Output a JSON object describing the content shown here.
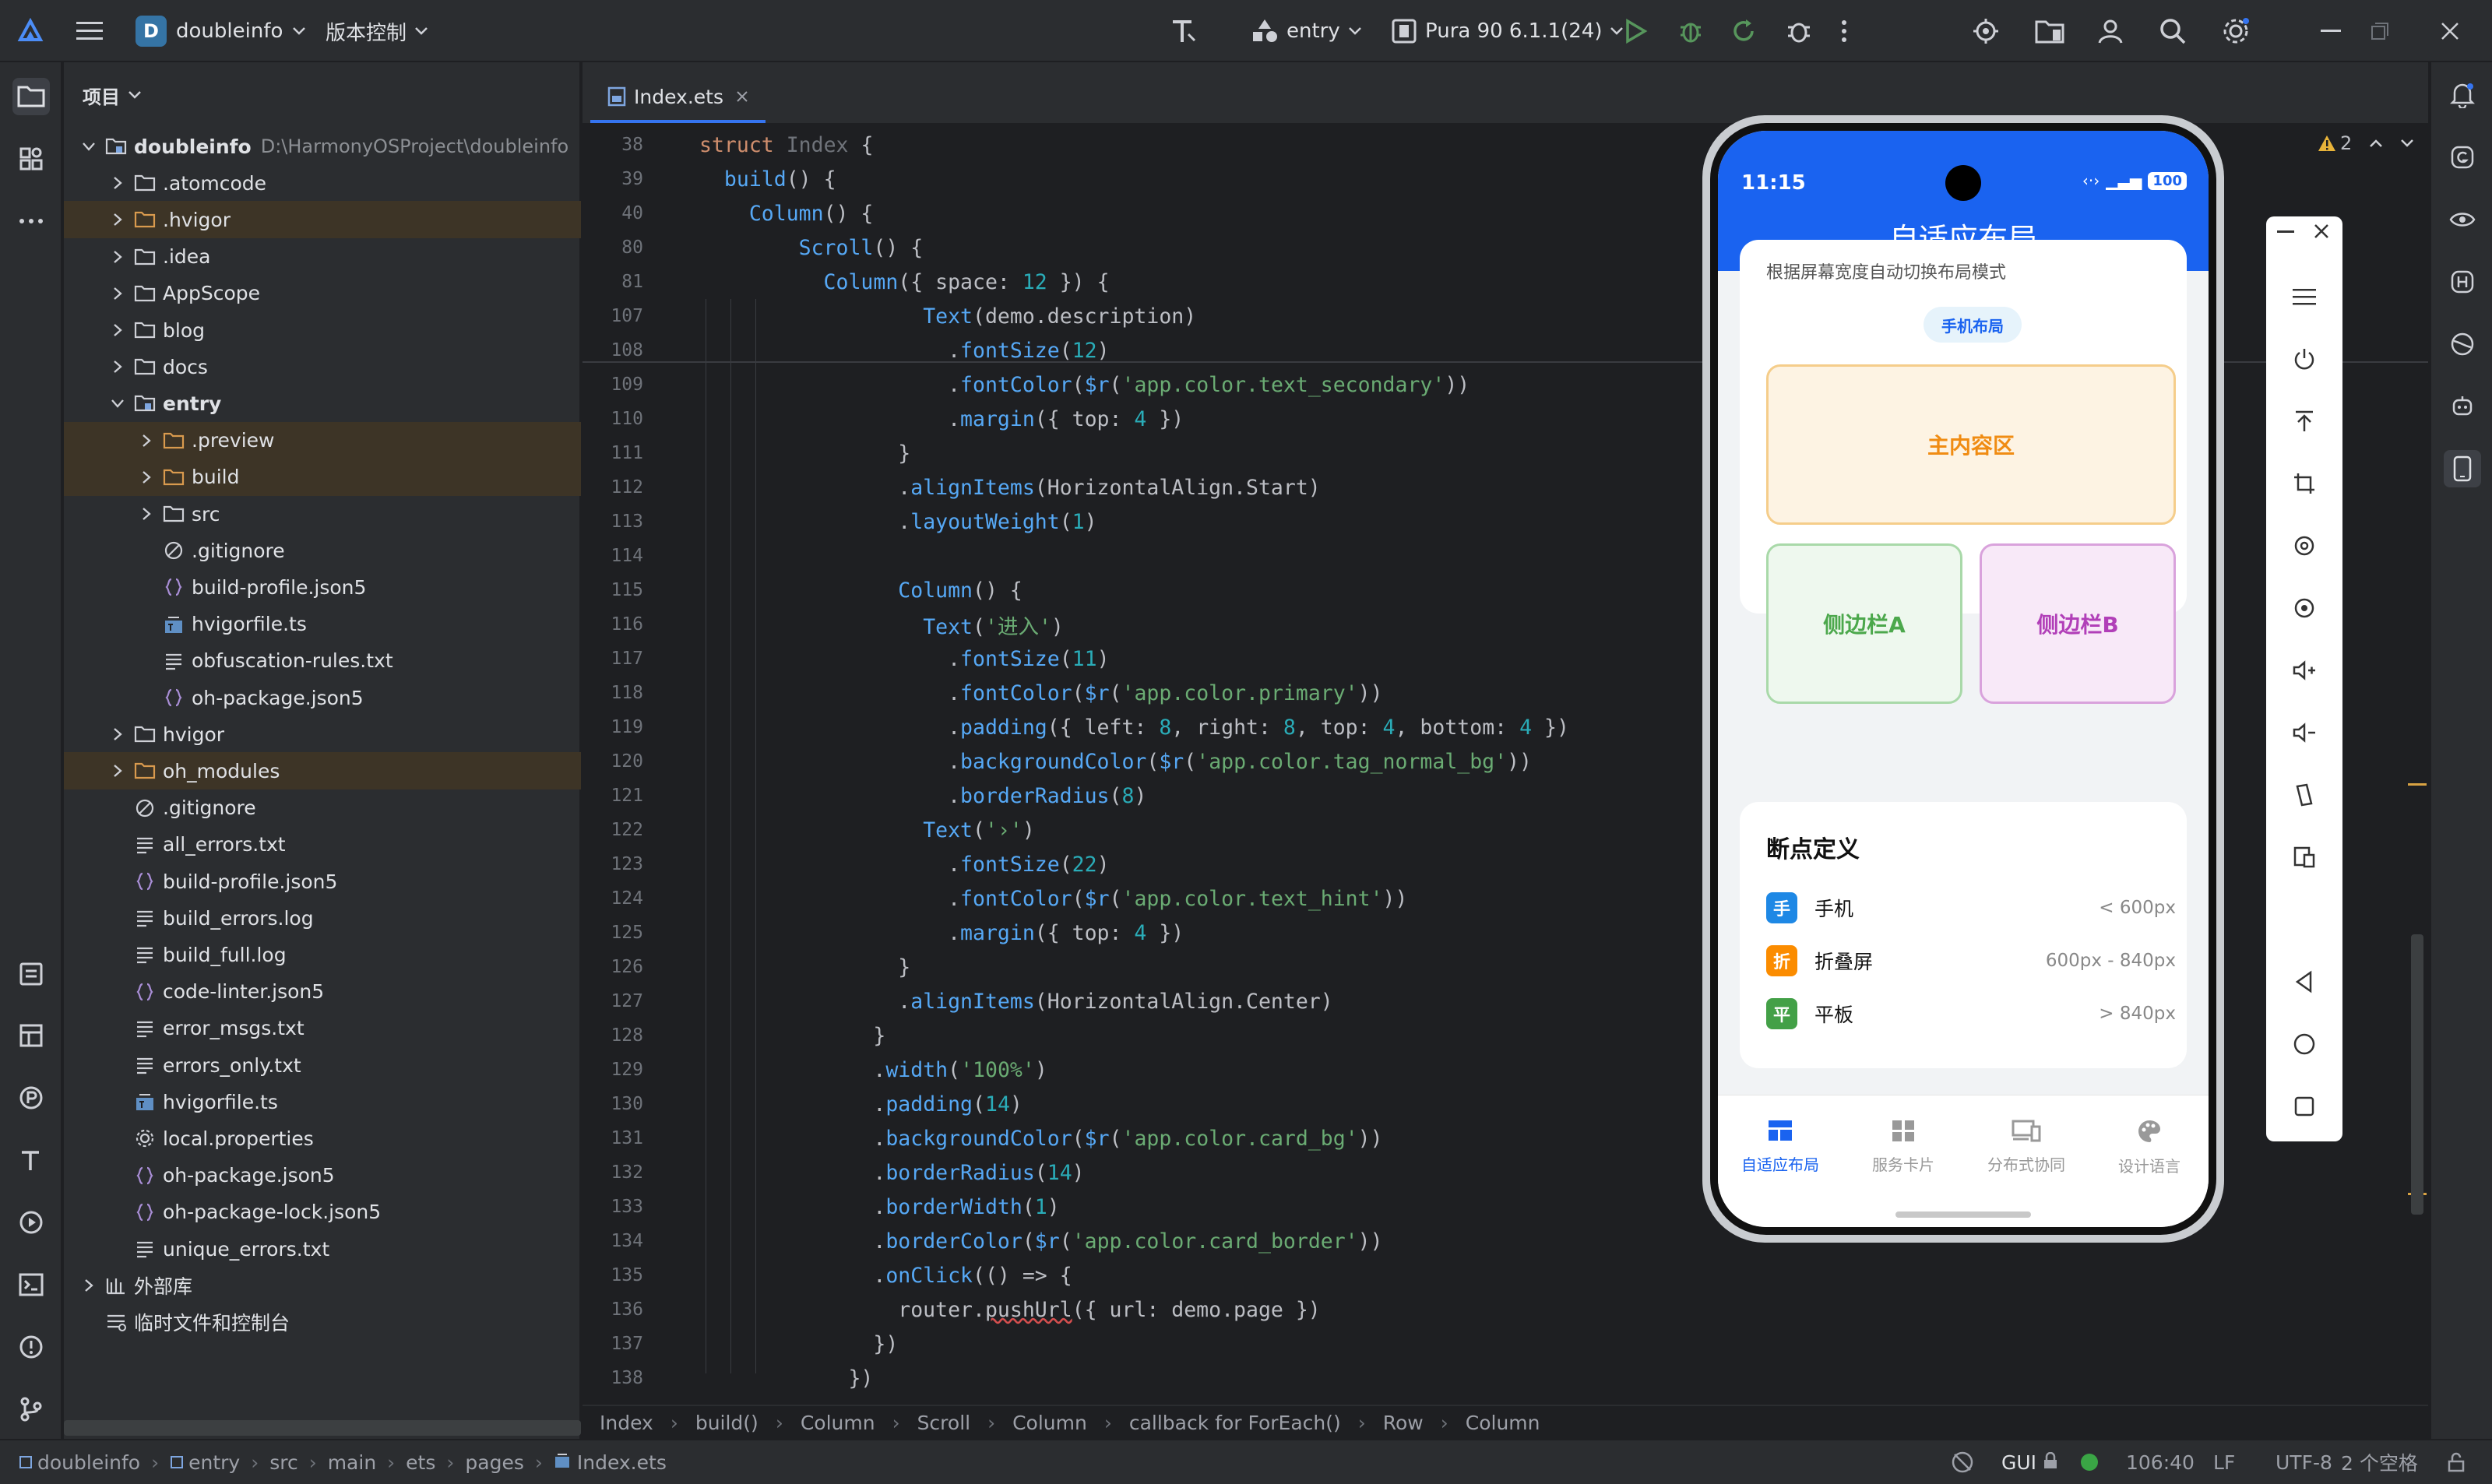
{
  "titlebar": {
    "project_badge": "D",
    "project_name": "doubleinfo",
    "vcs_label": "版本控制",
    "run_config": "entry",
    "device": "Pura 90 6.1.1(24)"
  },
  "project_panel": {
    "header": "项目",
    "items": [
      {
        "label": "doubleinfo",
        "hint": "D:\\HarmonyOSProject\\doubleinfo",
        "bold": true
      },
      {
        "label": ".atomcode"
      },
      {
        "label": ".hvigor"
      },
      {
        "label": ".idea"
      },
      {
        "label": "AppScope"
      },
      {
        "label": "blog"
      },
      {
        "label": "docs"
      },
      {
        "label": "entry",
        "bold": true
      },
      {
        "label": ".preview"
      },
      {
        "label": "build"
      },
      {
        "label": "src"
      },
      {
        "label": ".gitignore"
      },
      {
        "label": "build-profile.json5"
      },
      {
        "label": "hvigorfile.ts"
      },
      {
        "label": "obfuscation-rules.txt"
      },
      {
        "label": "oh-package.json5"
      },
      {
        "label": "hvigor"
      },
      {
        "label": "oh_modules"
      },
      {
        "label": ".gitignore"
      },
      {
        "label": "all_errors.txt"
      },
      {
        "label": "build-profile.json5"
      },
      {
        "label": "build_errors.log"
      },
      {
        "label": "build_full.log"
      },
      {
        "label": "code-linter.json5"
      },
      {
        "label": "error_msgs.txt"
      },
      {
        "label": "errors_only.txt"
      },
      {
        "label": "hvigorfile.ts"
      },
      {
        "label": "local.properties"
      },
      {
        "label": "oh-package.json5"
      },
      {
        "label": "oh-package-lock.json5"
      },
      {
        "label": "unique_errors.txt"
      },
      {
        "label": "外部库"
      },
      {
        "label": "临时文件和控制台"
      }
    ]
  },
  "editor": {
    "tab": "Index.ets",
    "warning_count": "2",
    "line_numbers": [
      "38",
      "39",
      "40",
      "80",
      "81",
      "107",
      "108",
      "109",
      "110",
      "111",
      "112",
      "113",
      "114",
      "115",
      "116",
      "117",
      "118",
      "119",
      "120",
      "121",
      "122",
      "123",
      "124",
      "125",
      "126",
      "127",
      "128",
      "129",
      "130",
      "131",
      "132",
      "133",
      "134",
      "135",
      "136",
      "137",
      "138"
    ],
    "breadcrumb": [
      "Index",
      "build()",
      "Column",
      "Scroll",
      "Column",
      "callback for ForEach()",
      "Row",
      "Column"
    ]
  },
  "phone": {
    "time": "11:15",
    "battery": "100",
    "title": "自适应布局",
    "card1_subtitle": "根据屏幕宽度自动切换布局模式",
    "mode_badge": "手机布局",
    "main_area": "主内容区",
    "side_a": "侧边栏A",
    "side_b": "侧边栏B",
    "breakpoints_title": "断点定义",
    "breakpoints": [
      {
        "icon": "手",
        "name": "手机",
        "range": "< 600px",
        "color": "#1e88e5"
      },
      {
        "icon": "折",
        "name": "折叠屏",
        "range": "600px - 840px",
        "color": "#fb8c00"
      },
      {
        "icon": "平",
        "name": "平板",
        "range": "> 840px",
        "color": "#43a047"
      }
    ],
    "nav": [
      {
        "label": "自适应布局",
        "icon": "layout-icon",
        "active": true
      },
      {
        "label": "服务卡片",
        "icon": "widgets-icon",
        "active": false
      },
      {
        "label": "分布式协同",
        "icon": "devices-icon",
        "active": false
      },
      {
        "label": "设计语言",
        "icon": "palette-icon",
        "active": false
      }
    ]
  },
  "statusbar": {
    "path": [
      "doubleinfo",
      "entry",
      "src",
      "main",
      "ets",
      "pages",
      "Index.ets"
    ],
    "gui": "GUI",
    "position": "106:40",
    "line_sep": "LF",
    "encoding": "UTF-8",
    "indent": "2 个空格"
  },
  "colors": {
    "accent": "#3574f0",
    "phone_primary": "#1a63f0"
  }
}
